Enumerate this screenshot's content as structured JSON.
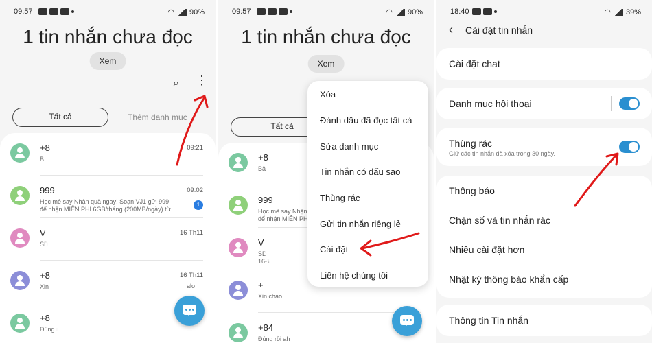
{
  "p1": {
    "status": {
      "time": "09:57",
      "battery": "90%"
    },
    "title": "1 tin nhắn chưa đọc",
    "view_button": "Xem",
    "tabs": {
      "all": "Tất cả",
      "add_category": "Thêm danh mục"
    },
    "rows": [
      {
        "name": "+8",
        "preview": "B",
        "time": "09:21",
        "color": "#7bc9a0"
      },
      {
        "name": "999",
        "preview": "Học mê say Nhận quà ngay! Soạn VJ1 gửi 999\nđể nhận MIỄN PHÍ 6GB/tháng (200MB/ngày) từ...",
        "time": "09:02",
        "color": "#8fd07a",
        "unread": "1"
      },
      {
        "name": "V",
        "preview": "SD",
        "time": "16 Th11",
        "color": "#e08ac0"
      },
      {
        "name": "+8",
        "preview": "Xin",
        "time": "16 Th11",
        "color": "#8c8ed8",
        "extra": "alo"
      },
      {
        "name": "+8",
        "preview": "Đúng r",
        "time": "",
        "color": "#7bc9a0"
      }
    ]
  },
  "p2": {
    "status": {
      "time": "09:57",
      "battery": "90%"
    },
    "title": "1 tin nhắn chưa đọc",
    "view_button": "Xem",
    "tabs": {
      "all": "Tất cả"
    },
    "rows": [
      {
        "name": "+8",
        "preview": "Bả",
        "color": "#7bc9a0"
      },
      {
        "name": "999",
        "preview": "Học mê say Nhận\nđể nhận MIỄN PHÍ",
        "color": "#8fd07a"
      },
      {
        "name": "V",
        "preview": "SD\n16-1",
        "color": "#e08ac0"
      },
      {
        "name": "+",
        "preview": "Xin chào",
        "color": "#8c8ed8"
      },
      {
        "name": "+84",
        "preview": "Đúng rồi ah",
        "color": "#7bc9a0"
      }
    ],
    "menu": [
      "Xóa",
      "Đánh dấu đã đọc tất cả",
      "Sửa danh mục",
      "Tin nhắn có dấu sao",
      "Thùng rác",
      "Gửi tin nhắn riêng lẻ",
      "Cài đặt",
      "Liên hệ chúng tôi"
    ]
  },
  "p3": {
    "status": {
      "time": "18:40",
      "battery": "39%"
    },
    "header_title": "Cài đặt tin nhắn",
    "items": {
      "chat": "Cài đặt chat",
      "categories": "Danh mục hội thoại",
      "trash": "Thùng rác",
      "trash_sub": "Giữ các tin nhắn đã xóa trong 30 ngày.",
      "notifications": "Thông báo",
      "block": "Chặn số và tin nhắn rác",
      "more": "Nhiều cài đặt hơn",
      "emergency": "Nhật ký thông báo khẩn cấp",
      "info": "Thông tin Tin nhắn"
    },
    "toggles": {
      "categories": true,
      "trash": true
    }
  },
  "colors": {
    "accent": "#2a8fd0",
    "arrow": "#e01a1a",
    "fab": "#3aa0d8"
  }
}
